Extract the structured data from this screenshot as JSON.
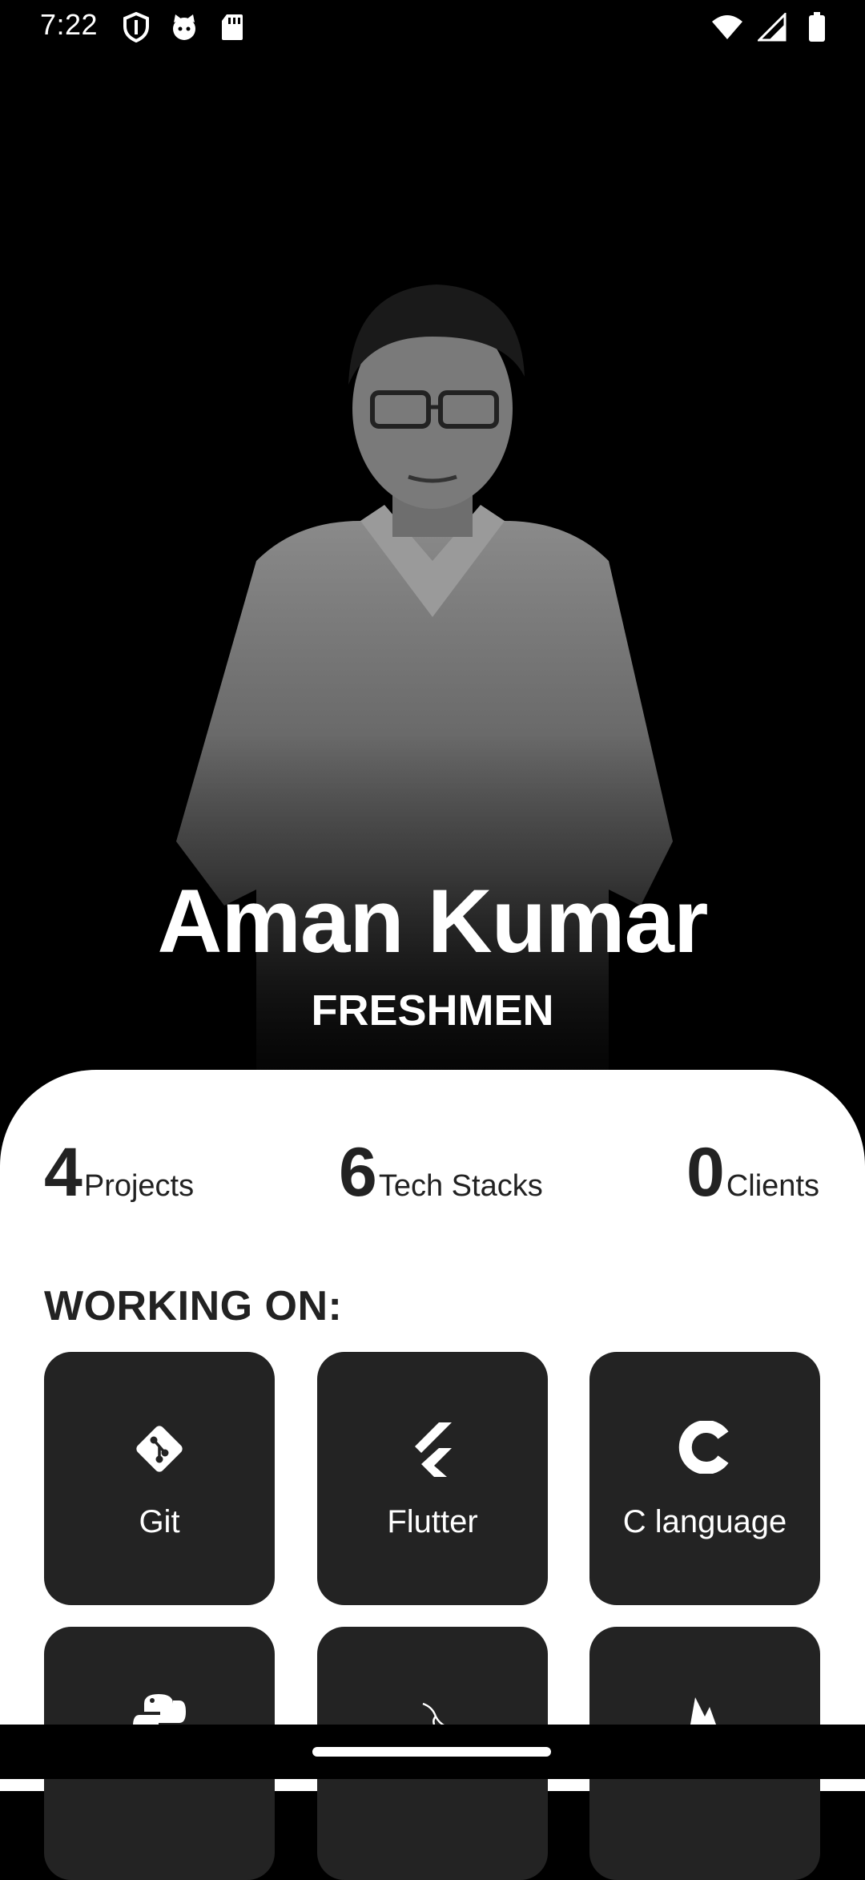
{
  "status_bar": {
    "time": "7:22",
    "left_icons": [
      "shield-icon",
      "cat-face-icon",
      "sd-card-icon"
    ],
    "right_icons": [
      "wifi-icon",
      "signal-icon",
      "battery-icon"
    ]
  },
  "profile": {
    "name": "Aman Kumar",
    "role": "FRESHMEN"
  },
  "stats": [
    {
      "value": "4",
      "label": "Projects"
    },
    {
      "value": "6",
      "label": "Tech Stacks"
    },
    {
      "value": "0",
      "label": "Clients"
    }
  ],
  "working_on": {
    "heading": "WORKING ON:",
    "items": [
      {
        "label": "Git",
        "icon": "git-icon"
      },
      {
        "label": "Flutter",
        "icon": "flutter-icon"
      },
      {
        "label": "C language",
        "icon": "c-language-icon"
      },
      {
        "label": "",
        "icon": "python-icon"
      },
      {
        "label": "",
        "icon": "mysql-dolphin-icon"
      },
      {
        "label": "",
        "icon": "firebase-icon"
      }
    ]
  },
  "colors": {
    "background": "#000000",
    "sheet": "#ffffff",
    "tile": "#232323",
    "text_dark": "#222222"
  }
}
